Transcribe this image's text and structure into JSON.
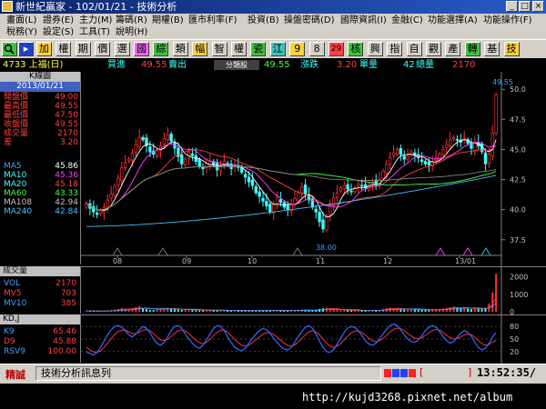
{
  "window": {
    "title": "新世紀贏家 - 102/01/21 - 技術分析"
  },
  "menu": {
    "row1": [
      "畫面(L)",
      "證券(E)",
      "主力(M)",
      "籌碼(R)",
      "期權(B)",
      "匯市利率(F)",
      "投資(B)",
      "操盤密碼(D)",
      "國際資訊(I)",
      "金融(C)",
      "功能選擇(A)",
      "功能操作(F)"
    ],
    "row2": [
      "稅務(Y)",
      "設定(S)",
      "工具(T)",
      "說明(H)"
    ]
  },
  "toolbar": {
    "buttons": [
      "加",
      "權",
      "期",
      "價",
      "選",
      "國",
      "綜",
      "類",
      "幅",
      "智",
      "權",
      "瓷",
      "江",
      "9",
      "8",
      "29",
      "核",
      "興",
      "指",
      "自",
      "觀",
      "產",
      "轉",
      "基",
      "技"
    ]
  },
  "quote": {
    "symbol": "4733 上福(日)",
    "bid_label": "買進",
    "bid": "49.55",
    "ask_label": "賣出",
    "tab": "分類股",
    "price": "49.55",
    "change_label": "漲跌",
    "change": "3.20",
    "qty_label": "單量",
    "qty": "42",
    "vol_label": "總量",
    "vol": "2170"
  },
  "kline_panel": {
    "title": "K線圖",
    "date": "2013/01/21",
    "fields": [
      {
        "label": "開盤價",
        "value": "49.00"
      },
      {
        "label": "最高價",
        "value": "49.55"
      },
      {
        "label": "最低價",
        "value": "47.50"
      },
      {
        "label": "收盤價",
        "value": "49.55"
      },
      {
        "label": "成交量",
        "value": "2170"
      },
      {
        "label": "差",
        "value": "3.20"
      }
    ],
    "ma": [
      {
        "label": "MA5",
        "value": "45.86"
      },
      {
        "label": "MA10",
        "value": "45.36"
      },
      {
        "label": "MA20",
        "value": "45.18"
      },
      {
        "label": "MA60",
        "value": "43.33"
      },
      {
        "label": "MA108",
        "value": "42.94"
      },
      {
        "label": "MA240",
        "value": "42.84"
      }
    ]
  },
  "volume_panel": {
    "title": "成交量",
    "fields": [
      {
        "label": "VOL",
        "value": "2170"
      },
      {
        "label": "MV5",
        "value": "703"
      },
      {
        "label": "MV10",
        "value": "385"
      }
    ]
  },
  "kd_panel": {
    "title": "KD,J",
    "fields": [
      {
        "label": "K9",
        "value": "65.46"
      },
      {
        "label": "D9",
        "value": "45.88"
      },
      {
        "label": "RSV9",
        "value": "100.00"
      }
    ]
  },
  "colors": {
    "ma5": "#ffffff",
    "ma10": "#ff40ff",
    "ma20": "#ff4040",
    "ma60": "#40ff40",
    "ma108": "#808080",
    "ma240": "#40c0ff",
    "up": "#ff3030",
    "down": "#40ffff",
    "k_line": "#3060ff",
    "d_line": "#ff3030"
  },
  "chart_data": [
    {
      "type": "candlestick",
      "title": "K線圖",
      "x_ticks": [
        "08",
        "09",
        "10",
        "11",
        "12",
        "13/01"
      ],
      "ylim": [
        36.5,
        51
      ],
      "y_ticks": [
        37.5,
        40.0,
        42.5,
        45.0,
        47.5,
        50.0
      ],
      "last_price_label": "49.55",
      "low_annotation": "38.00",
      "close": [
        40.5,
        40.1,
        39.8,
        39.6,
        39.9,
        40.2,
        40.8,
        41.3,
        42.0,
        42.6,
        43.5,
        43.9,
        44.2,
        44.7,
        45.4,
        46.0,
        45.8,
        45.3,
        44.8,
        44.6,
        44.9,
        45.3,
        45.9,
        46.2,
        45.7,
        45.1,
        44.4,
        43.8,
        44.2,
        44.8,
        44.5,
        44.0,
        43.6,
        43.4,
        43.8,
        44.0,
        43.7,
        43.3,
        43.6,
        44.0,
        43.8,
        43.4,
        43.7,
        43.5,
        43.1,
        42.7,
        42.3,
        42.0,
        41.4,
        41.1,
        40.7,
        40.3,
        39.8,
        40.4,
        41.0,
        40.6,
        40.2,
        40.0,
        40.4,
        40.9,
        41.4,
        41.9,
        41.3,
        40.8,
        40.2,
        39.8,
        39.0,
        38.4,
        39.5,
        40.5,
        41.0,
        41.4,
        41.8,
        42.0,
        41.7,
        41.5,
        41.8,
        42.1,
        42.0,
        41.8,
        42.1,
        42.3,
        42.1,
        42.5,
        43.2,
        43.8,
        44.3,
        44.7,
        45.0,
        44.6,
        44.2,
        44.4,
        44.8,
        44.5,
        44.3,
        44.0,
        43.8,
        43.7,
        44.0,
        44.3,
        44.6,
        45.0,
        45.4,
        45.8,
        46.0,
        45.8,
        45.6,
        45.9,
        45.5,
        45.1,
        45.6,
        45.3,
        44.8,
        43.8,
        44.6,
        46.35,
        49.55
      ],
      "ma_series": [
        {
          "name": "MA5",
          "values_first_last": [
            40.3,
            45.86
          ]
        },
        {
          "name": "MA10",
          "values_first_last": [
            40.6,
            45.36
          ]
        },
        {
          "name": "MA20",
          "values_first_last": [
            41.0,
            45.18
          ]
        },
        {
          "name": "MA60",
          "values_first_last": [
            42.0,
            43.33
          ]
        },
        {
          "name": "MA108",
          "values_first_last": [
            43.0,
            42.94
          ]
        },
        {
          "name": "MA240",
          "values_first_last": [
            38.6,
            42.84
          ]
        }
      ]
    },
    {
      "type": "bar",
      "title": "成交量",
      "ylim": [
        0,
        2400
      ],
      "y_ticks": [
        0,
        1000,
        2000
      ],
      "values": [
        60,
        40,
        35,
        30,
        50,
        45,
        70,
        90,
        120,
        150,
        220,
        180,
        140,
        160,
        260,
        310,
        200,
        150,
        110,
        100,
        120,
        160,
        200,
        230,
        170,
        140,
        120,
        100,
        130,
        150,
        110,
        90,
        80,
        70,
        100,
        95,
        80,
        75,
        90,
        100,
        85,
        70,
        80,
        75,
        70,
        65,
        60,
        55,
        80,
        70,
        65,
        60,
        90,
        110,
        100,
        80,
        70,
        60,
        75,
        90,
        110,
        120,
        100,
        80,
        70,
        90,
        160,
        200,
        230,
        190,
        120,
        110,
        100,
        90,
        80,
        75,
        80,
        85,
        80,
        75,
        80,
        90,
        85,
        100,
        160,
        210,
        240,
        200,
        180,
        150,
        120,
        140,
        160,
        130,
        120,
        110,
        100,
        95,
        110,
        130,
        150,
        180,
        220,
        260,
        300,
        250,
        200,
        230,
        180,
        160,
        200,
        170,
        150,
        220,
        480,
        1100,
        2170
      ]
    },
    {
      "type": "line",
      "title": "KD,J",
      "ylim": [
        0,
        100
      ],
      "y_ticks": [
        20,
        50,
        80
      ],
      "series": [
        {
          "name": "K9",
          "values": [
            20,
            15,
            12,
            18,
            30,
            45,
            60,
            72,
            80,
            82,
            78,
            70,
            60,
            55,
            62,
            72,
            80,
            76,
            65,
            50,
            40,
            35,
            42,
            55,
            70,
            80,
            82,
            75,
            62,
            50,
            40,
            32,
            28,
            35,
            48,
            62,
            75,
            82,
            80,
            70,
            55,
            42,
            30,
            25,
            22,
            28,
            40,
            52,
            62,
            70,
            75,
            72,
            64,
            52,
            42,
            32,
            26,
            24,
            30,
            42,
            56,
            68,
            78,
            82,
            76,
            62,
            45,
            30,
            20,
            18,
            25,
            38,
            52,
            66,
            76,
            80,
            78,
            70,
            58,
            46,
            38,
            35,
            40,
            50,
            62,
            74,
            82,
            86,
            82,
            72,
            60,
            50,
            44,
            42,
            48,
            58,
            70,
            78,
            82,
            78,
            68,
            56,
            46,
            40,
            44,
            54,
            64,
            70,
            66,
            56,
            42,
            30,
            24,
            28,
            40,
            55,
            65.46
          ]
        },
        {
          "name": "D9",
          "values": [
            30,
            24,
            19,
            18,
            22,
            30,
            40,
            51,
            61,
            68,
            71,
            71,
            67,
            63,
            63,
            66,
            71,
            73,
            70,
            63,
            55,
            48,
            46,
            49,
            56,
            64,
            70,
            72,
            69,
            63,
            55,
            47,
            41,
            39,
            42,
            49,
            58,
            66,
            71,
            71,
            66,
            58,
            49,
            41,
            35,
            33,
            35,
            41,
            48,
            55,
            62,
            65,
            65,
            61,
            55,
            47,
            40,
            35,
            33,
            36,
            43,
            51,
            60,
            67,
            70,
            67,
            60,
            50,
            40,
            33,
            30,
            33,
            39,
            48,
            57,
            65,
            69,
            69,
            65,
            59,
            52,
            46,
            44,
            46,
            51,
            59,
            67,
            73,
            76,
            75,
            70,
            63,
            57,
            52,
            51,
            53,
            59,
            65,
            71,
            73,
            71,
            66,
            59,
            53,
            50,
            51,
            55,
            60,
            62,
            60,
            54,
            46,
            39,
            35,
            37,
            43,
            45.88
          ]
        }
      ]
    }
  ],
  "status": {
    "label": "精誠",
    "message": "技術分析訊息列",
    "time": "13:52:35/"
  },
  "footer": {
    "url": "http://kujd3268.pixnet.net/album"
  }
}
